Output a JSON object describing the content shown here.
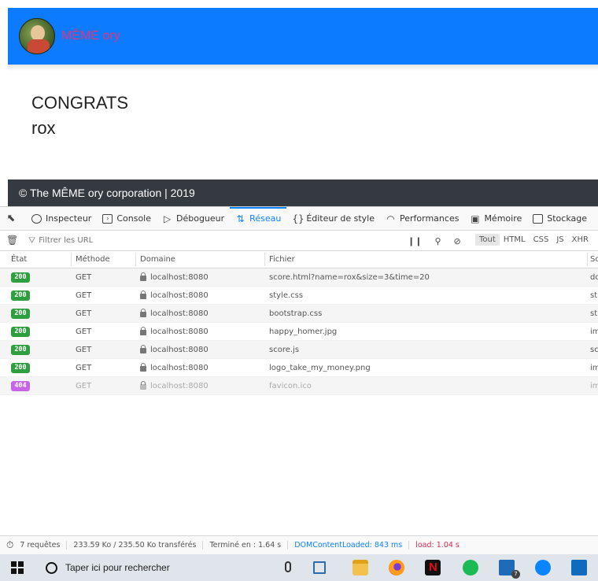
{
  "page": {
    "brand": "MÊME ory",
    "congrats": "CONGRATS",
    "username": "rox",
    "footer": "© The MÊME ory corporation | 2019"
  },
  "devtools": {
    "tabs": [
      {
        "label": "Inspecteur",
        "icon": "inspector-icon"
      },
      {
        "label": "Console",
        "icon": "console-icon"
      },
      {
        "label": "Débogueur",
        "icon": "debugger-icon"
      },
      {
        "label": "Réseau",
        "icon": "network-icon",
        "active": true
      },
      {
        "label": "Éditeur de style",
        "icon": "style-editor-icon"
      },
      {
        "label": "Performances",
        "icon": "performance-icon"
      },
      {
        "label": "Mémoire",
        "icon": "memory-icon"
      },
      {
        "label": "Stockage",
        "icon": "storage-icon"
      }
    ],
    "filter_placeholder": "Filtrer les URL",
    "type_filters": [
      "Tout",
      "HTML",
      "CSS",
      "JS",
      "XHR"
    ],
    "selected_type": "Tout",
    "columns": [
      "État",
      "Méthode",
      "Domaine",
      "Fichier",
      "So"
    ],
    "rows": [
      {
        "status": "200",
        "method": "GET",
        "domain": "localhost:8080",
        "file": "score.html?name=rox&size=3&time=20",
        "src": "do"
      },
      {
        "status": "200",
        "method": "GET",
        "domain": "localhost:8080",
        "file": "style.css",
        "src": "st"
      },
      {
        "status": "200",
        "method": "GET",
        "domain": "localhost:8080",
        "file": "bootstrap.css",
        "src": "st"
      },
      {
        "status": "200",
        "method": "GET",
        "domain": "localhost:8080",
        "file": "happy_homer.jpg",
        "src": "im"
      },
      {
        "status": "200",
        "method": "GET",
        "domain": "localhost:8080",
        "file": "score.js",
        "src": "sc"
      },
      {
        "status": "200",
        "method": "GET",
        "domain": "localhost:8080",
        "file": "logo_take_my_money.png",
        "src": "im"
      },
      {
        "status": "404",
        "method": "GET",
        "domain": "localhost:8080",
        "file": "favicon.ico",
        "src": "im"
      }
    ],
    "summary": {
      "requests": "7 requêtes",
      "transferred": "233.59 Ko / 235.50 Ko transférés",
      "finished": "Terminé en : 1.64 s",
      "dom_content_loaded": "DOMContentLoaded: 843 ms",
      "load": "load: 1.04 s"
    }
  },
  "taskbar": {
    "search_placeholder": "Taper ici pour rechercher",
    "mail_badge": "7"
  },
  "colors": {
    "navbar": "#0d7bff",
    "brand_text": "#e0357a",
    "footer": "#343a40",
    "status_ok": "#2e9e3e",
    "status_error": "#c864e6",
    "active_tab": "#0a84ff"
  }
}
